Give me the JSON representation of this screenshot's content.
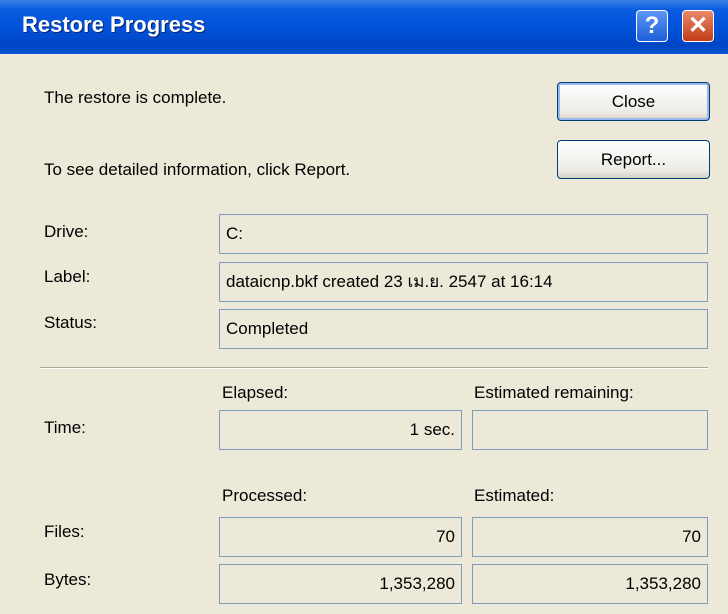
{
  "window": {
    "title": "Restore Progress"
  },
  "titlebar_buttons": {
    "help": "?",
    "close": "✕"
  },
  "message": {
    "complete": "The restore is complete.",
    "report_hint": "To see detailed information, click Report."
  },
  "buttons": {
    "close": "Close",
    "report": "Report..."
  },
  "drive": {
    "label": "Drive:",
    "value": "C:"
  },
  "label": {
    "label": "Label:",
    "value": "dataicnp.bkf created 23 เม.ย. 2547 at 16:14"
  },
  "status": {
    "label": "Status:",
    "value": "Completed"
  },
  "time": {
    "label": "Time:",
    "elapsed_header": "Elapsed:",
    "remaining_header": "Estimated remaining:",
    "elapsed": "1 sec.",
    "remaining": ""
  },
  "files": {
    "processed_header": "Processed:",
    "estimated_header": "Estimated:",
    "label": "Files:",
    "processed": "70",
    "estimated": "70"
  },
  "bytes": {
    "label": "Bytes:",
    "processed": "1,353,280",
    "estimated": "1,353,280"
  }
}
